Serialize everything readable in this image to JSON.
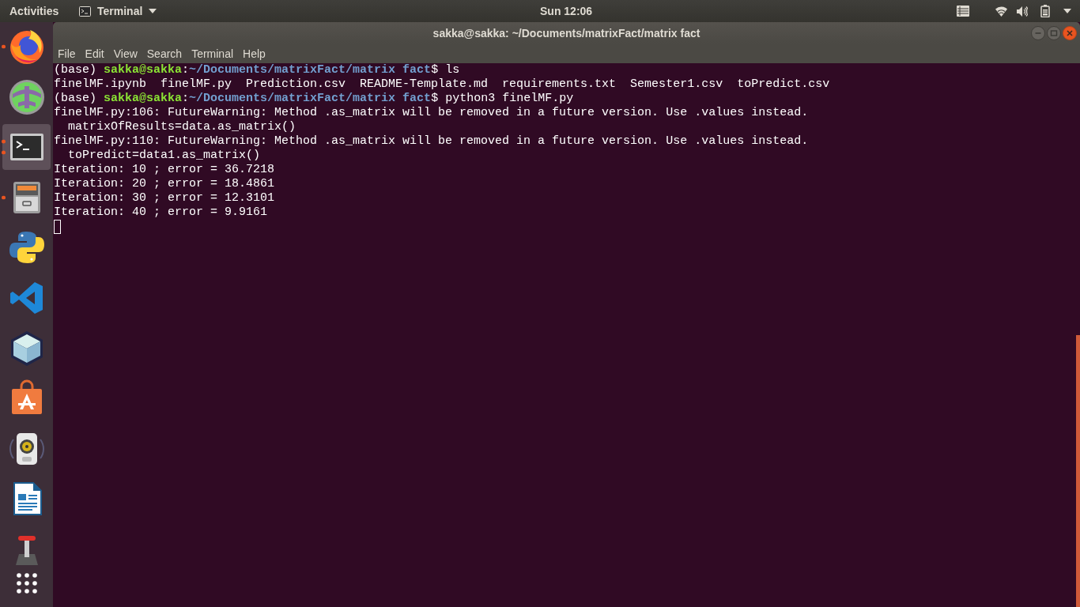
{
  "top_bar": {
    "activities": "Activities",
    "app_menu": "Terminal",
    "clock": "Sun 12:06"
  },
  "dock": {
    "items": [
      {
        "kind": "fox",
        "selected": false,
        "running": true,
        "second_window": false
      },
      {
        "kind": "globe",
        "selected": false,
        "running": false,
        "second_window": false
      },
      {
        "kind": "terminal",
        "selected": true,
        "running": true,
        "second_window": true
      },
      {
        "kind": "cabinet",
        "selected": false,
        "running": true,
        "second_window": false
      },
      {
        "kind": "snakes",
        "selected": false,
        "running": false,
        "second_window": false
      },
      {
        "kind": "ribbon",
        "selected": false,
        "running": false,
        "second_window": false
      },
      {
        "kind": "cube",
        "selected": false,
        "running": false,
        "second_window": false
      },
      {
        "kind": "bag",
        "selected": false,
        "running": false,
        "second_window": false
      },
      {
        "kind": "speaker",
        "selected": false,
        "running": false,
        "second_window": false
      },
      {
        "kind": "document",
        "selected": false,
        "running": false,
        "second_window": false
      },
      {
        "kind": "lever",
        "selected": false,
        "running": false,
        "second_window": false
      },
      {
        "kind": "grid",
        "selected": false,
        "running": false,
        "second_window": false
      }
    ]
  },
  "window": {
    "title": "sakka@sakka: ~/Documents/matrixFact/matrix fact",
    "menu": [
      "File",
      "Edit",
      "View",
      "Search",
      "Terminal",
      "Help"
    ],
    "terminal": {
      "lines": [
        {
          "kind": "prompt",
          "env": "(base)",
          "user": "sakka@sakka",
          "separator": ":",
          "path": "~/Documents/matrixFact/matrix fact",
          "symbol": "$",
          "command": "ls"
        },
        {
          "kind": "output",
          "text": "finelMF.ipynb  finelMF.py  Prediction.csv  README-Template.md  requirements.txt  Semester1.csv  toPredict.csv"
        },
        {
          "kind": "prompt",
          "env": "(base)",
          "user": "sakka@sakka",
          "separator": ":",
          "path": "~/Documents/matrixFact/matrix fact",
          "symbol": "$",
          "command": "python3 finelMF.py"
        },
        {
          "kind": "output",
          "text": "finelMF.py:106: FutureWarning: Method .as_matrix will be removed in a future version. Use .values instead."
        },
        {
          "kind": "output",
          "text": "  matrixOfResults=data.as_matrix()"
        },
        {
          "kind": "output",
          "text": "finelMF.py:110: FutureWarning: Method .as_matrix will be removed in a future version. Use .values instead."
        },
        {
          "kind": "output",
          "text": "  toPredict=data1.as_matrix()"
        },
        {
          "kind": "output",
          "text": "Iteration: 10 ; error = 36.7218"
        },
        {
          "kind": "output",
          "text": "Iteration: 20 ; error = 18.4861"
        },
        {
          "kind": "output",
          "text": "Iteration: 30 ; error = 12.3101"
        },
        {
          "kind": "output",
          "text": "Iteration: 40 ; error = 9.9161"
        }
      ],
      "cursor": {
        "visible": true,
        "filled": false
      }
    }
  }
}
